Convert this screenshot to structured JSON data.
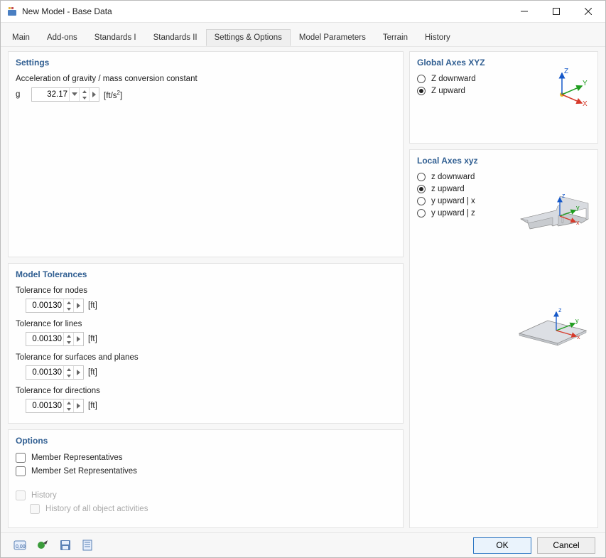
{
  "title": "New Model - Base Data",
  "tabs": [
    "Main",
    "Add-ons",
    "Standards I",
    "Standards II",
    "Settings & Options",
    "Model Parameters",
    "Terrain",
    "History"
  ],
  "active_tab": "Settings & Options",
  "settings": {
    "header": "Settings",
    "gravity_label": "Acceleration of gravity / mass conversion constant",
    "g_sym": "g",
    "g_val": "32.17",
    "g_unit": "[ft/s²]"
  },
  "tolerances": {
    "header": "Model Tolerances",
    "nodes_label": "Tolerance for nodes",
    "nodes_val": "0.00130",
    "lines_label": "Tolerance for lines",
    "lines_val": "0.00130",
    "surfaces_label": "Tolerance for surfaces and planes",
    "surfaces_val": "0.00130",
    "directions_label": "Tolerance for directions",
    "directions_val": "0.00130",
    "unit": "[ft]"
  },
  "options": {
    "header": "Options",
    "member_rep": "Member Representatives",
    "member_set_rep": "Member Set Representatives",
    "history": "History",
    "history_all": "History of all object activities"
  },
  "global_axes": {
    "header": "Global Axes XYZ",
    "z_down": "Z downward",
    "z_up": "Z upward"
  },
  "local_axes": {
    "header": "Local Axes xyz",
    "z_down": "z downward",
    "z_up": "z upward",
    "y_up_x": "y upward | x",
    "y_up_z": "y upward | z"
  },
  "buttons": {
    "ok": "OK",
    "cancel": "Cancel"
  }
}
